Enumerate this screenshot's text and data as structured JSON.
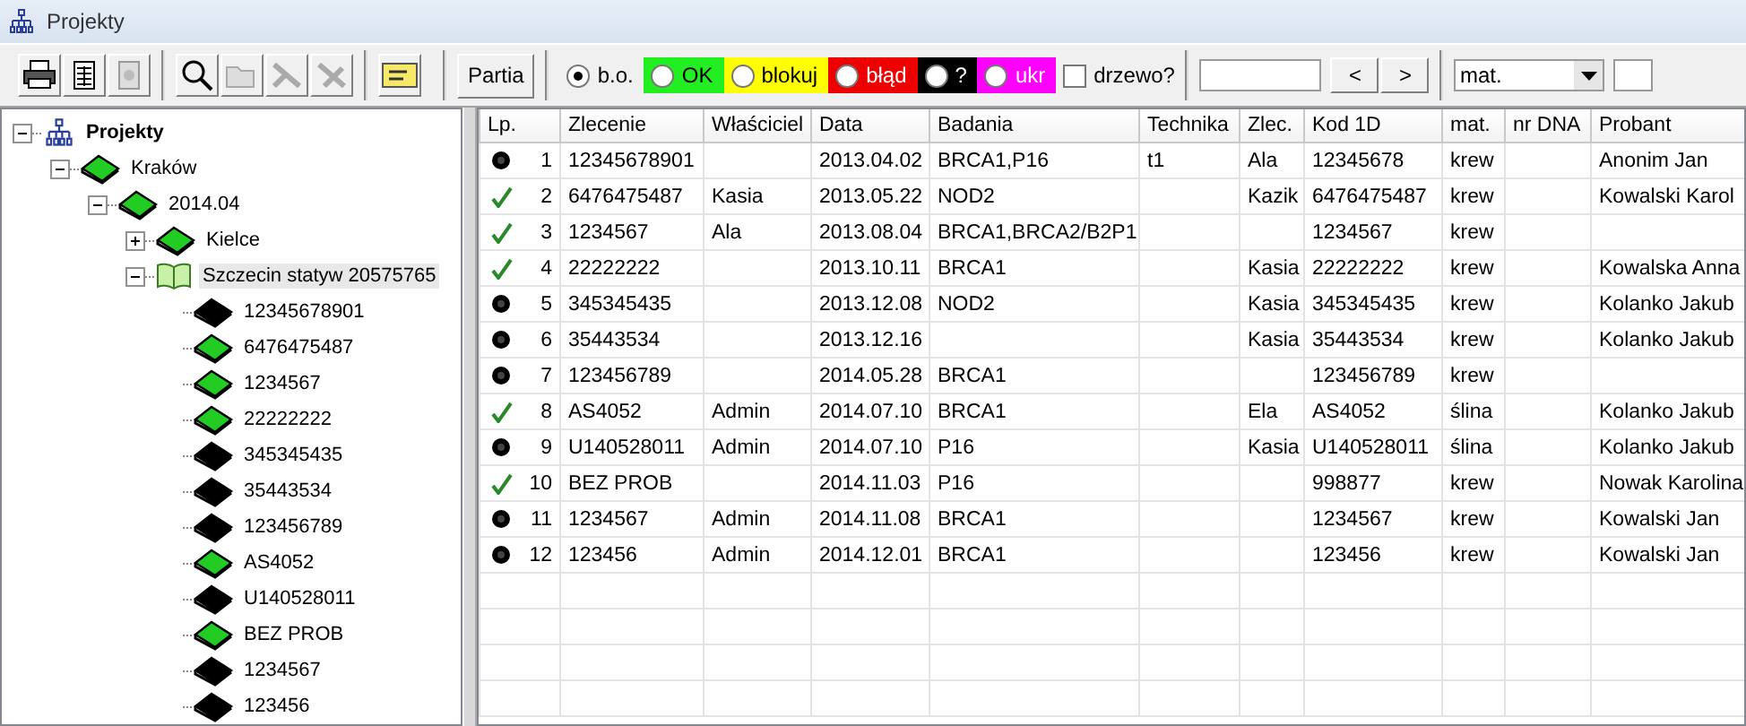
{
  "window": {
    "title": "Projekty"
  },
  "toolbar": {
    "partia_button": "Partia",
    "radios": [
      {
        "label": "b.o.",
        "selected": true
      },
      {
        "label": "OK",
        "selected": false,
        "color": "#22ee22"
      },
      {
        "label": "blokuj",
        "selected": false,
        "color": "#ffff00"
      },
      {
        "label": "błąd",
        "selected": false,
        "color": "#ee0000"
      },
      {
        "label": "?",
        "selected": false,
        "color": "#000000"
      },
      {
        "label": "ukr",
        "selected": false,
        "color": "#ff00ff"
      }
    ],
    "tree_checkbox": {
      "label": "drzewo?",
      "checked": false
    },
    "prev_button": "<",
    "next_button": ">",
    "material_select": {
      "value": "mat."
    }
  },
  "tree": {
    "label": "Projekty",
    "kind": "root",
    "expanded": true,
    "selected": false,
    "children": [
      {
        "label": "Kraków",
        "kind": "book",
        "color": "#22cc22",
        "expanded": true,
        "selected": false,
        "children": [
          {
            "label": "2014.04",
            "kind": "book",
            "color": "#22cc22",
            "expanded": true,
            "selected": false,
            "children": [
              {
                "label": "Kielce",
                "kind": "book",
                "color": "#22cc22",
                "expanded": false,
                "selected": false
              },
              {
                "label": "Szczecin statyw 20575765",
                "kind": "open-book",
                "expanded": true,
                "selected": true,
                "children": [
                  {
                    "label": "12345678901",
                    "kind": "book",
                    "color": "#000000",
                    "selected": false
                  },
                  {
                    "label": "6476475487",
                    "kind": "book",
                    "color": "#22cc22",
                    "selected": false
                  },
                  {
                    "label": "1234567",
                    "kind": "book",
                    "color": "#22cc22",
                    "selected": false
                  },
                  {
                    "label": "22222222",
                    "kind": "book",
                    "color": "#22cc22",
                    "selected": false
                  },
                  {
                    "label": "345345435",
                    "kind": "book",
                    "color": "#000000",
                    "selected": false
                  },
                  {
                    "label": "35443534",
                    "kind": "book",
                    "color": "#000000",
                    "selected": false
                  },
                  {
                    "label": "123456789",
                    "kind": "book",
                    "color": "#000000",
                    "selected": false
                  },
                  {
                    "label": "AS4052",
                    "kind": "book",
                    "color": "#22cc22",
                    "selected": false
                  },
                  {
                    "label": "U140528011",
                    "kind": "book",
                    "color": "#000000",
                    "selected": false
                  },
                  {
                    "label": "BEZ PROB",
                    "kind": "book",
                    "color": "#22cc22",
                    "selected": false
                  },
                  {
                    "label": "1234567",
                    "kind": "book",
                    "color": "#000000",
                    "selected": false
                  },
                  {
                    "label": "123456",
                    "kind": "book",
                    "color": "#000000",
                    "selected": false
                  }
                ]
              }
            ]
          }
        ]
      }
    ]
  },
  "table": {
    "columns": [
      "Lp.",
      "Zlecenie",
      "Właściciel",
      "Data",
      "Badania",
      "Technika",
      "Zlec.",
      "Kod 1D",
      "mat.",
      "nr DNA",
      "Probant"
    ],
    "rows": [
      {
        "kind": "dot",
        "lp": "1",
        "zlecenie": "12345678901",
        "data": "2013.04.02",
        "badania": "BRCA1,P16",
        "technika": "t1",
        "zlec": "Ala",
        "kod_1d": "12345678",
        "mat": "krew",
        "probant": "Anonim Jan"
      },
      {
        "kind": "check",
        "lp": "2",
        "zlecenie": "6476475487",
        "wlasciciel": "Kasia",
        "data": "2013.05.22",
        "badania": "NOD2",
        "zlec": "Kazik",
        "kod_1d": "6476475487",
        "mat": "krew",
        "probant": "Kowalski Karol"
      },
      {
        "kind": "check",
        "lp": "3",
        "zlecenie": "1234567",
        "wlasciciel": "Ala",
        "data": "2013.08.04",
        "badania": "BRCA1,BRCA2/B2P1",
        "kod_1d": "1234567",
        "mat": "krew"
      },
      {
        "kind": "check",
        "lp": "4",
        "zlecenie": "22222222",
        "data": "2013.10.11",
        "badania": "BRCA1",
        "zlec": "Kasia",
        "kod_1d": "22222222",
        "mat": "krew",
        "probant": "Kowalska Anna"
      },
      {
        "kind": "dot",
        "lp": "5",
        "zlecenie": "345345435",
        "data": "2013.12.08",
        "badania": "NOD2",
        "zlec": "Kasia",
        "kod_1d": "345345435",
        "mat": "krew",
        "probant": "Kolanko Jakub"
      },
      {
        "kind": "dot",
        "lp": "6",
        "zlecenie": "35443534",
        "data": "2013.12.16",
        "zlec": "Kasia",
        "kod_1d": "35443534",
        "mat": "krew",
        "probant": "Kolanko Jakub"
      },
      {
        "kind": "dot",
        "lp": "7",
        "zlecenie": "123456789",
        "data": "2014.05.28",
        "badania": "BRCA1",
        "kod_1d": "123456789",
        "mat": "krew"
      },
      {
        "kind": "check",
        "lp": "8",
        "zlecenie": "AS4052",
        "wlasciciel": "Admin",
        "data": "2014.07.10",
        "badania": "BRCA1",
        "zlec": "Ela",
        "kod_1d": "AS4052",
        "mat": "ślina",
        "probant": "Kolanko Jakub"
      },
      {
        "kind": "dot",
        "lp": "9",
        "zlecenie": "U140528011",
        "wlasciciel": "Admin",
        "data": "2014.07.10",
        "badania": "P16",
        "zlec": "Kasia",
        "kod_1d": "U140528011",
        "mat": "ślina",
        "probant": "Kolanko Jakub"
      },
      {
        "kind": "check",
        "lp": "10",
        "zlecenie": "BEZ PROB",
        "data": "2014.11.03",
        "badania": "P16",
        "kod_1d": "998877",
        "mat": "krew",
        "probant": "Nowak Karolina"
      },
      {
        "kind": "dot",
        "lp": "11",
        "zlecenie": "1234567",
        "wlasciciel": "Admin",
        "data": "2014.11.08",
        "badania": "BRCA1",
        "kod_1d": "1234567",
        "mat": "krew",
        "probant": "Kowalski Jan"
      },
      {
        "kind": "dot",
        "lp": "12",
        "zlecenie": "123456",
        "wlasciciel": "Admin",
        "data": "2014.12.01",
        "badania": "BRCA1",
        "kod_1d": "123456",
        "mat": "krew",
        "probant": "Kowalski Jan"
      }
    ]
  }
}
